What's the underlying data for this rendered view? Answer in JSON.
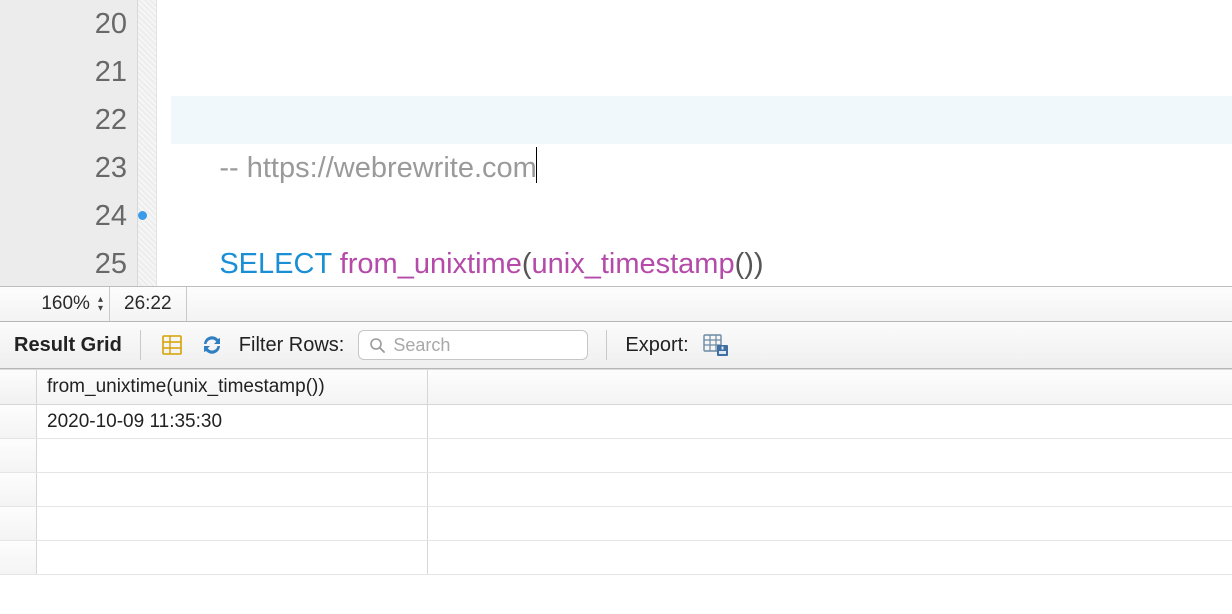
{
  "editor": {
    "lines": [
      {
        "num": "20",
        "tokens": []
      },
      {
        "num": "21",
        "tokens": []
      },
      {
        "num": "22",
        "tokens": []
      },
      {
        "num": "23",
        "tokens": []
      },
      {
        "num": "24",
        "tokens": []
      },
      {
        "num": "25",
        "tokens": []
      }
    ],
    "comment_text": "-- https://webrewrite.com",
    "keyword": "SELECT",
    "func1": "from_unixtime",
    "func2": "unix_timestamp",
    "paren_open": "(",
    "paren_close": ")",
    "empty_parens": "()"
  },
  "statusbar": {
    "zoom": "160%",
    "cursor_pos": "26:22"
  },
  "toolbar": {
    "result_grid_label": "Result Grid",
    "filter_label": "Filter Rows:",
    "search_placeholder": "Search",
    "export_label": "Export:"
  },
  "results": {
    "columns": [
      "from_unixtime(unix_timestamp())"
    ],
    "rows": [
      [
        "2020-10-09 11:35:30"
      ]
    ],
    "empty_row_count": 4
  },
  "icons": {
    "grid": "grid-icon",
    "refresh": "refresh-icon",
    "export": "export-icon",
    "search": "search-icon",
    "stepper_up": "▴",
    "stepper_down": "▾"
  }
}
